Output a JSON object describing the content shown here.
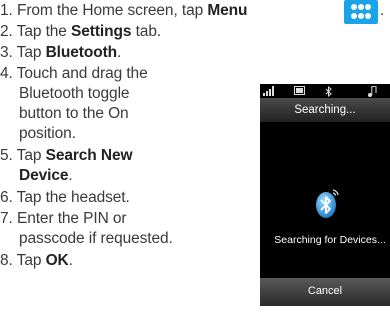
{
  "steps": [
    {
      "num": "1.",
      "pre": "From the Home screen, tap ",
      "bold": "Menu",
      "post": " ."
    },
    {
      "num": "2.",
      "pre": "Tap the ",
      "bold": "Settings",
      "post": " tab."
    },
    {
      "num": "3.",
      "pre": "Tap ",
      "bold": "Bluetooth",
      "post": "."
    },
    {
      "num": "4.",
      "lines": [
        "Touch and drag the",
        "Bluetooth toggle",
        "button to the On",
        "position."
      ]
    },
    {
      "num": "5.",
      "pre": "Tap ",
      "bold": "Search New",
      "bold2": "Device",
      "post": "."
    },
    {
      "num": "6.",
      "pre": "Tap the headset."
    },
    {
      "num": "7.",
      "lines": [
        "Enter the PIN or",
        "passcode if requested."
      ]
    },
    {
      "num": "8.",
      "pre": "Tap ",
      "bold": "OK",
      "post": "."
    }
  ],
  "menu_icon": "menu-grid-icon",
  "phone": {
    "header": "Searching...",
    "message": "Searching for Devices...",
    "cancel_label": "Cancel",
    "status_icons": [
      "signal-icon",
      "battery-icon",
      "bluetooth-icon",
      "music-icon"
    ]
  },
  "colors": {
    "accent": "#1aa3e8",
    "text": "#3a3a3a",
    "screen_bg": "#000000"
  }
}
